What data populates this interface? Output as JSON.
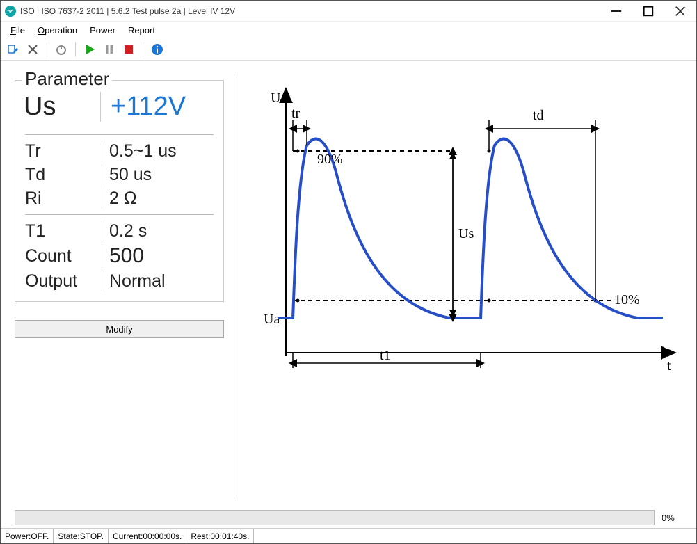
{
  "window": {
    "title": "ISO | ISO 7637-2 2011 | 5.6.2 Test pulse 2a | Level IV 12V"
  },
  "menu": {
    "file": "File",
    "operation": "Operation",
    "power": "Power",
    "report": "Report"
  },
  "toolbar": {
    "edit": "edit",
    "cancel": "cancel",
    "power": "power",
    "play": "play",
    "pause": "pause",
    "stop": "stop",
    "info": "info"
  },
  "panel": {
    "legend": "Parameter",
    "us_label": "Us",
    "us_value": "+112V",
    "rows1": [
      {
        "k": "Tr",
        "v": "0.5~1 us"
      },
      {
        "k": "Td",
        "v": "50 us"
      },
      {
        "k": "Ri",
        "v": "2 Ω"
      }
    ],
    "rows2": [
      {
        "k": "T1",
        "v": "0.2 s"
      },
      {
        "k": "Count",
        "v": "500"
      },
      {
        "k": "Output",
        "v": "Normal"
      }
    ],
    "modify": "Modify"
  },
  "chart": {
    "y_axis": "U",
    "x_axis": "t",
    "ua": "Ua",
    "us": "Us",
    "tr": "tr",
    "td": "td",
    "t1": "t1",
    "p90": "90%",
    "p10": "10%"
  },
  "progress": {
    "pct": "0%"
  },
  "status": {
    "power": "Power:OFF.",
    "state": "State:STOP.",
    "current": "Current:00:00:00s.",
    "rest": "Rest:00:01:40s."
  },
  "chart_data": {
    "type": "line",
    "title": "Test pulse 2a waveform",
    "xlabel": "t",
    "ylabel": "U",
    "baseline": "Ua",
    "peak_label": "Us",
    "peak_value_V": 112,
    "annotations": {
      "tr": "rise time marker",
      "td": "decay duration marker",
      "t1": "pulse period marker",
      "levels": [
        "90%",
        "10%"
      ]
    },
    "parameters": {
      "Tr_us": "0.5~1",
      "Td_us": 50,
      "T1_s": 0.2,
      "Ri_ohm": 2,
      "Count": 500
    },
    "series": [
      {
        "name": "pulse",
        "shape": "exponential-decay-pulse-train",
        "n_pulses_shown": 2
      }
    ]
  }
}
